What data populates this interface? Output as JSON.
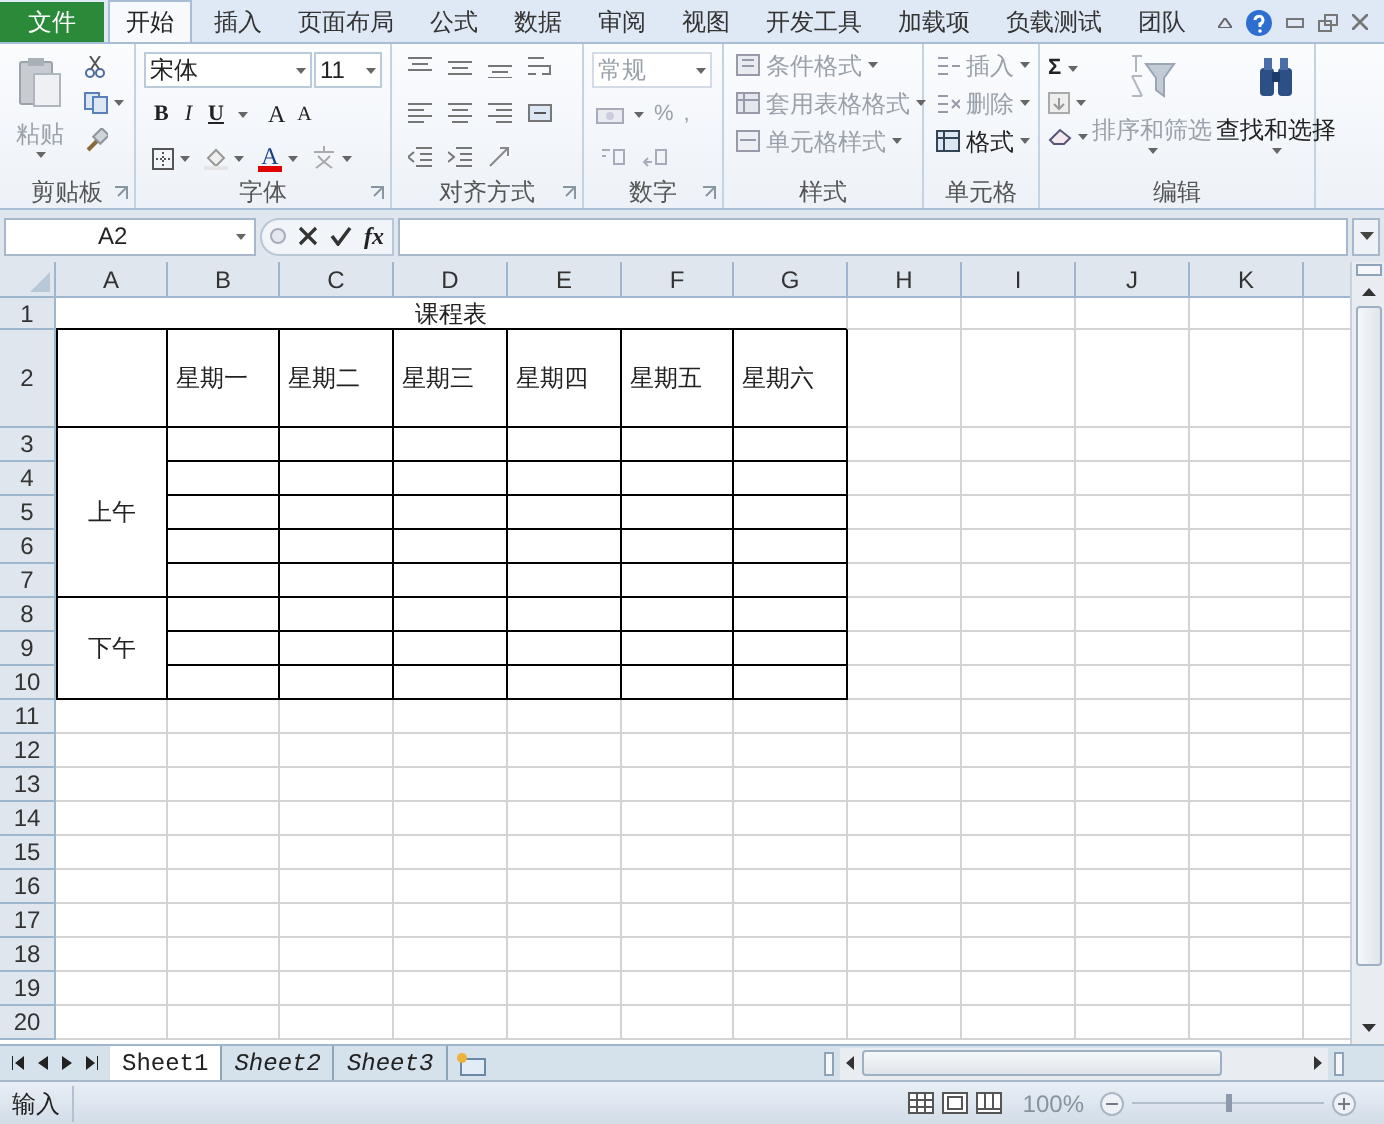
{
  "menu_tabs": [
    {
      "label": "文件",
      "kind": "file",
      "selected": false
    },
    {
      "label": "开始",
      "kind": "tab",
      "selected": true
    },
    {
      "label": "插入",
      "kind": "tab",
      "selected": false
    },
    {
      "label": "页面布局",
      "kind": "tab",
      "selected": false
    },
    {
      "label": "公式",
      "kind": "tab",
      "selected": false
    },
    {
      "label": "数据",
      "kind": "tab",
      "selected": false
    },
    {
      "label": "审阅",
      "kind": "tab",
      "selected": false
    },
    {
      "label": "视图",
      "kind": "tab",
      "selected": false
    },
    {
      "label": "开发工具",
      "kind": "tab",
      "selected": false
    },
    {
      "label": "加载项",
      "kind": "tab",
      "selected": false
    },
    {
      "label": "负载测试",
      "kind": "tab",
      "selected": false
    },
    {
      "label": "团队",
      "kind": "tab",
      "selected": false
    }
  ],
  "ribbon": {
    "groups": [
      {
        "label": "剪贴板",
        "kind": "clipboard",
        "paste": {
          "label": "粘贴",
          "disabled": true
        }
      },
      {
        "label": "字体",
        "kind": "font",
        "font": "宋体",
        "size": "11",
        "format_buttons": [
          "B",
          "I",
          "U"
        ],
        "grow": "A",
        "shrink": "A",
        "font_color": "A"
      },
      {
        "label": "对齐方式",
        "kind": "align"
      },
      {
        "label": "数字",
        "kind": "number",
        "format": "常规",
        "symbols": [
          "%",
          ","
        ]
      },
      {
        "label": "样式",
        "kind": "styles",
        "items": [
          {
            "label": "条件格式",
            "disabled": true
          },
          {
            "label": "套用表格格式",
            "disabled": true
          },
          {
            "label": "单元格样式",
            "disabled": true
          }
        ]
      },
      {
        "label": "单元格",
        "kind": "cells",
        "items": [
          {
            "label": "插入",
            "disabled": true
          },
          {
            "label": "删除",
            "disabled": true
          },
          {
            "label": "格式",
            "disabled": false
          }
        ]
      },
      {
        "label": "编辑",
        "kind": "editing",
        "sum": "Σ",
        "items": [
          {
            "label": "排序和筛选",
            "disabled": true
          },
          {
            "label": "查找和选择",
            "disabled": false
          }
        ]
      }
    ]
  },
  "formula_bar": {
    "name_box": "A2",
    "function_label": "fx"
  },
  "sheet": {
    "columns": [
      "A",
      "B",
      "C",
      "D",
      "E",
      "F",
      "G",
      "H",
      "I",
      "J",
      "K"
    ],
    "rows": [
      "1",
      "2",
      "3",
      "4",
      "5",
      "6",
      "7",
      "8",
      "9",
      "10",
      "11",
      "12",
      "13",
      "14",
      "15",
      "16",
      "17",
      "18",
      "19",
      "20"
    ],
    "title": "课程表",
    "header_cells": [
      "星期一",
      "星期二",
      "星期三",
      "星期四",
      "星期五",
      "星期六"
    ],
    "periods": [
      {
        "label": "上午"
      },
      {
        "label": "下午"
      }
    ]
  },
  "sheet_tabs": [
    {
      "label": "Sheet1",
      "selected": true
    },
    {
      "label": "Sheet2",
      "selected": false
    },
    {
      "label": "Sheet3",
      "selected": false
    }
  ],
  "status_bar": {
    "mode": "输入",
    "zoom": "100%",
    "zoom_slider": {
      "level": 0.5
    }
  }
}
